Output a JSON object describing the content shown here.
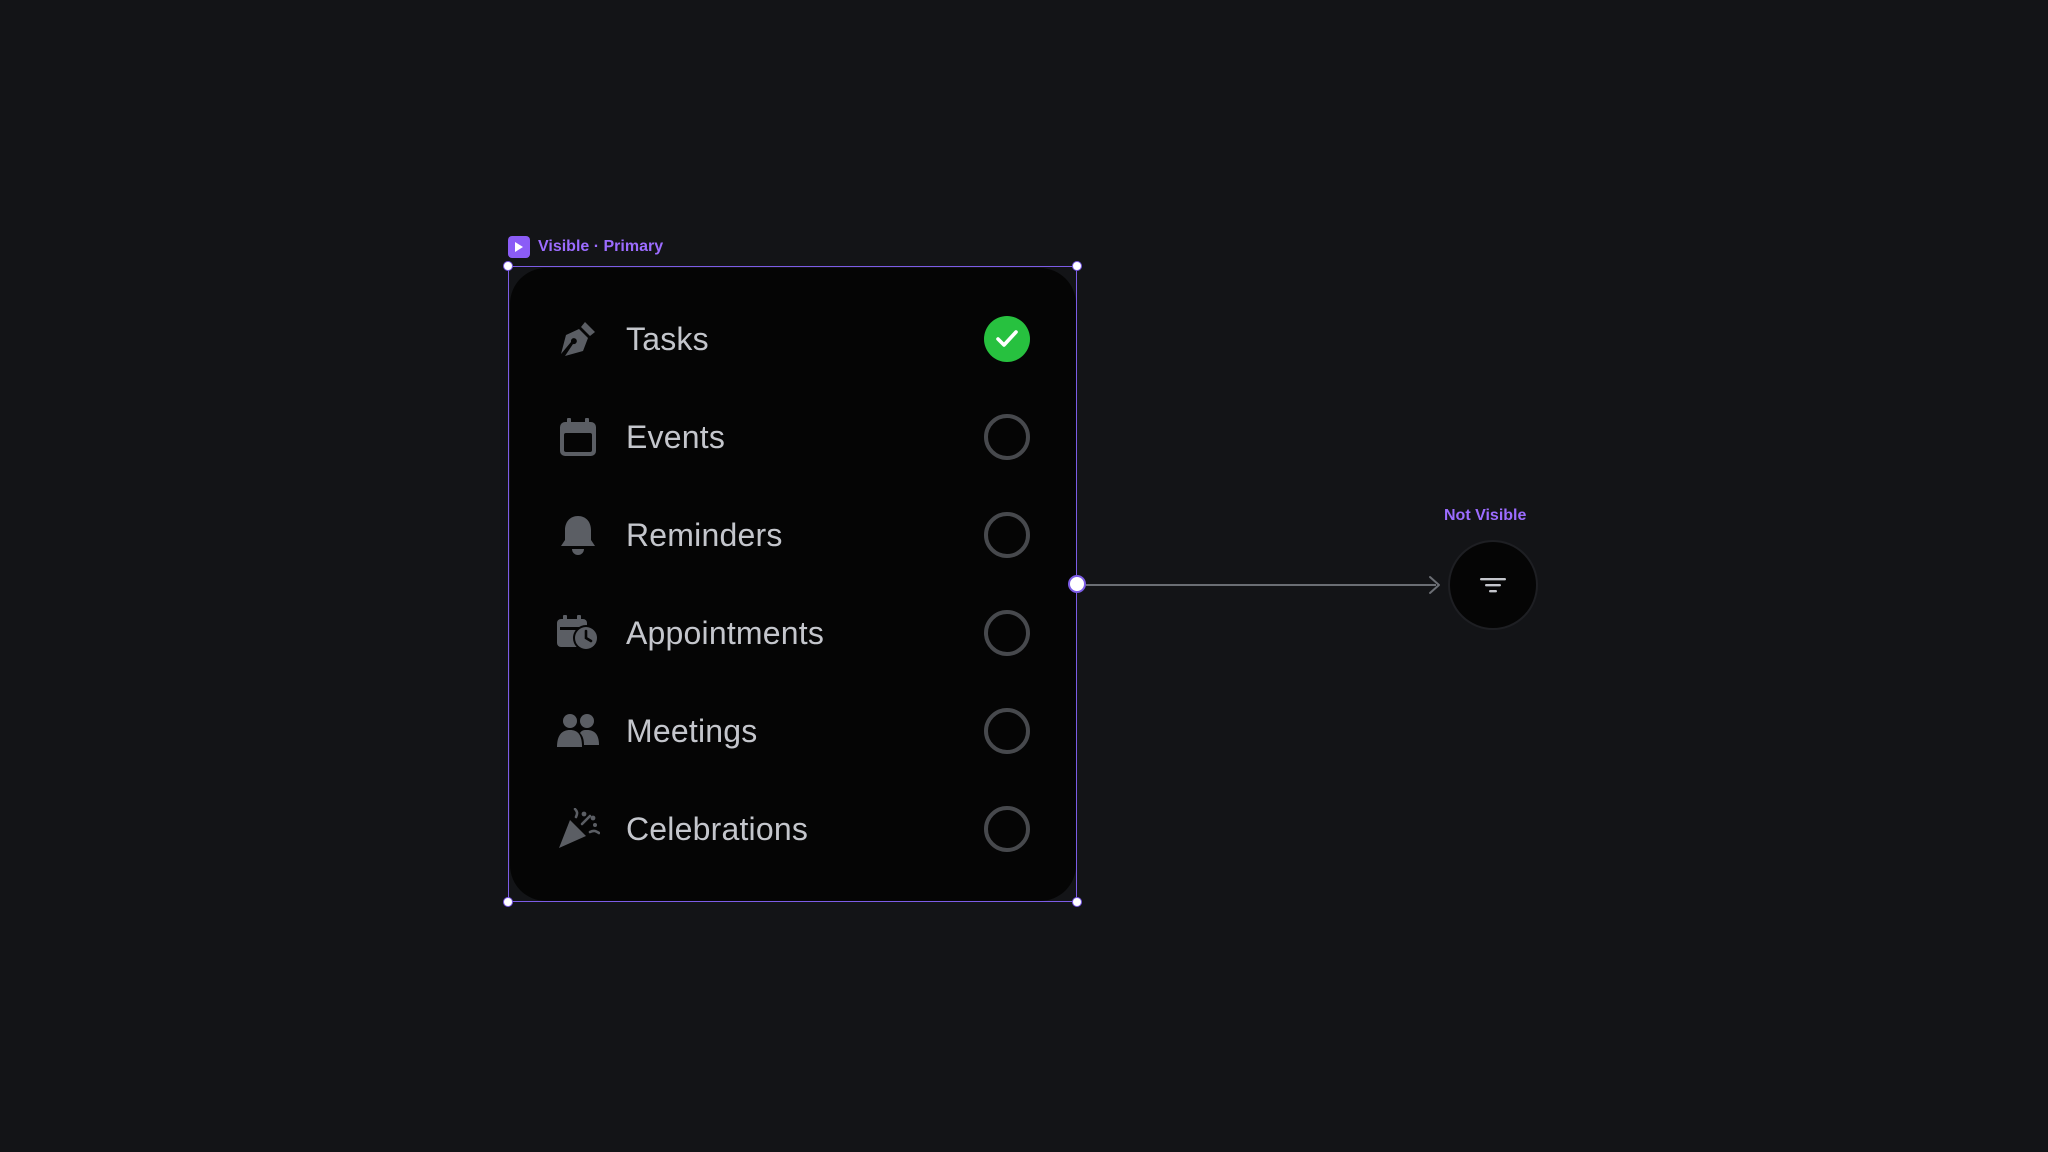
{
  "frame": {
    "label": "Visible · Primary",
    "accent_color": "#8b5cf6"
  },
  "list": {
    "items": [
      {
        "label": "Tasks",
        "icon": "pen-nib-icon",
        "checked": true
      },
      {
        "label": "Events",
        "icon": "calendar-icon",
        "checked": false
      },
      {
        "label": "Reminders",
        "icon": "bell-icon",
        "checked": false
      },
      {
        "label": "Appointments",
        "icon": "calendar-clock-icon",
        "checked": false
      },
      {
        "label": "Meetings",
        "icon": "people-icon",
        "checked": false
      },
      {
        "label": "Celebrations",
        "icon": "party-popper-icon",
        "checked": false
      }
    ],
    "check_color": "#27c13f"
  },
  "target_node": {
    "label": "Not Visible",
    "icon": "filter-icon"
  }
}
